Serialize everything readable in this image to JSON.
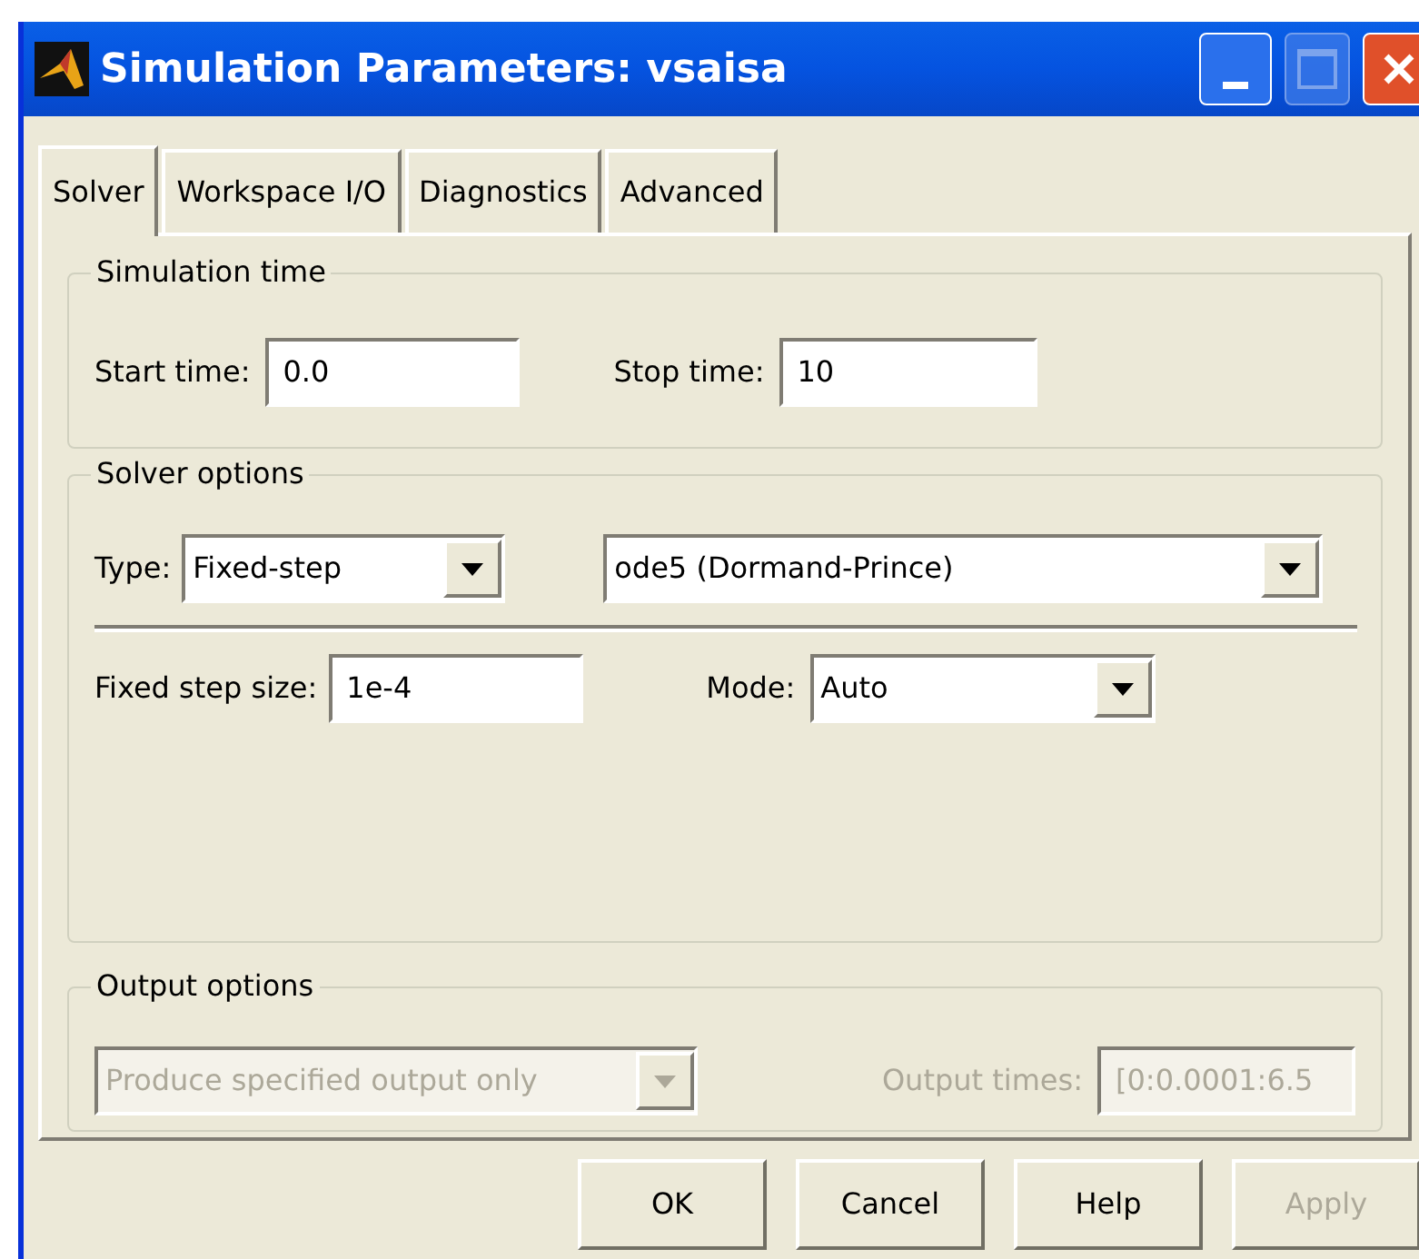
{
  "window": {
    "title": "Simulation Parameters: vsaisa"
  },
  "tabs": [
    {
      "label": "Solver",
      "selected": true
    },
    {
      "label": "Workspace I/O",
      "selected": false
    },
    {
      "label": "Diagnostics",
      "selected": false
    },
    {
      "label": "Advanced",
      "selected": false
    }
  ],
  "simulation_time": {
    "title": "Simulation time",
    "start_time": {
      "label": "Start time:",
      "value": "0.0"
    },
    "stop_time": {
      "label": "Stop time:",
      "value": "10"
    }
  },
  "solver_options": {
    "title": "Solver options",
    "type": {
      "label": "Type:",
      "value": "Fixed-step"
    },
    "solver": {
      "value": "ode5 (Dormand-Prince)"
    },
    "fixed_step_size": {
      "label": "Fixed step size:",
      "value": "1e-4"
    },
    "mode": {
      "label": "Mode:",
      "value": "Auto"
    }
  },
  "output_options": {
    "title": "Output options",
    "output": {
      "value": "Produce specified output only",
      "disabled": true
    },
    "output_times": {
      "label": "Output times:",
      "value": "[0:0.0001:6.5",
      "disabled": true
    }
  },
  "buttons": [
    {
      "label": "OK",
      "disabled": false
    },
    {
      "label": "Cancel",
      "disabled": false
    },
    {
      "label": "Help",
      "disabled": false
    },
    {
      "label": "Apply",
      "disabled": true
    }
  ]
}
